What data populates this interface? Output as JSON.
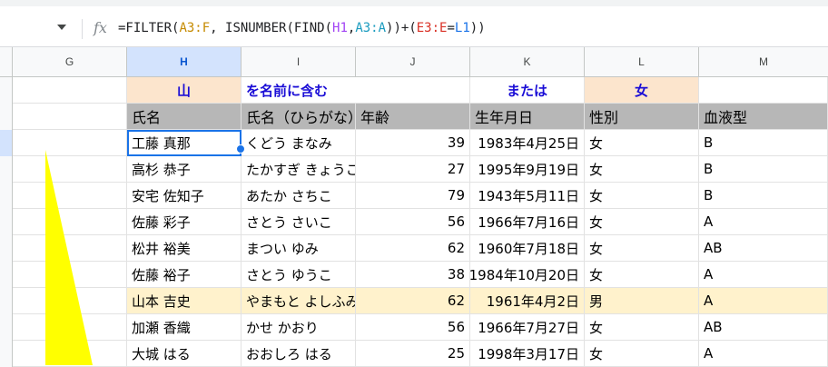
{
  "formula_bar": {
    "formula_parts": [
      {
        "text": "=FILTER(",
        "color": "#202124"
      },
      {
        "text": "A3:F",
        "color": "#c58a00"
      },
      {
        "text": ", ISNUMBER(FIND(",
        "color": "#202124"
      },
      {
        "text": "H1",
        "color": "#a142f4"
      },
      {
        "text": ",",
        "color": "#202124"
      },
      {
        "text": "A3:A",
        "color": "#1a9bbf"
      },
      {
        "text": "))+(",
        "color": "#202124"
      },
      {
        "text": "E3:E",
        "color": "#d93025"
      },
      {
        "text": "=",
        "color": "#202124"
      },
      {
        "text": "L1",
        "color": "#1a73e8"
      },
      {
        "text": "))",
        "color": "#202124"
      }
    ]
  },
  "columns": [
    "G",
    "H",
    "I",
    "J",
    "K",
    "L",
    "M"
  ],
  "criteria_row": {
    "h": "山",
    "i": "を名前に含む",
    "k": "または",
    "l": "女"
  },
  "header_row": [
    "氏名",
    "氏名（ひらがな）",
    "年齢",
    "生年月日",
    "性別",
    "血液型"
  ],
  "rows": [
    [
      "工藤 真那",
      "くどう まなみ",
      "39",
      "1983年4月25日",
      "女",
      "B"
    ],
    [
      "高杉 恭子",
      "たかすぎ きょうこ",
      "27",
      "1995年9月19日",
      "女",
      "B"
    ],
    [
      "安宅 佐知子",
      "あたか さちこ",
      "79",
      "1943年5月11日",
      "女",
      "B"
    ],
    [
      "佐藤 彩子",
      "さとう さいこ",
      "56",
      "1966年7月16日",
      "女",
      "A"
    ],
    [
      "松井 裕美",
      "まつい ゆみ",
      "62",
      "1960年7月18日",
      "女",
      "AB"
    ],
    [
      "佐藤 裕子",
      "さとう ゆうこ",
      "38",
      "1984年10月20日",
      "女",
      "A"
    ],
    [
      "山本 吉史",
      "やまもと よしふみ",
      "62",
      "1961年4月2日",
      "男",
      "A"
    ],
    [
      "加瀬 香織",
      "かせ かおり",
      "56",
      "1966年7月27日",
      "女",
      "AB"
    ],
    [
      "大城 はる",
      "おおしろ はる",
      "25",
      "1998年3月17日",
      "女",
      "A"
    ]
  ],
  "highlighted_row_index": 6,
  "colors": {
    "criteria_fill": "#fce5cd",
    "criteria_text": "#1a0dd6",
    "header_fill": "#b7b7b7",
    "highlight_fill": "#fff2cc",
    "annotation_shape": "#ffff00",
    "selection": "#1a73e8"
  }
}
